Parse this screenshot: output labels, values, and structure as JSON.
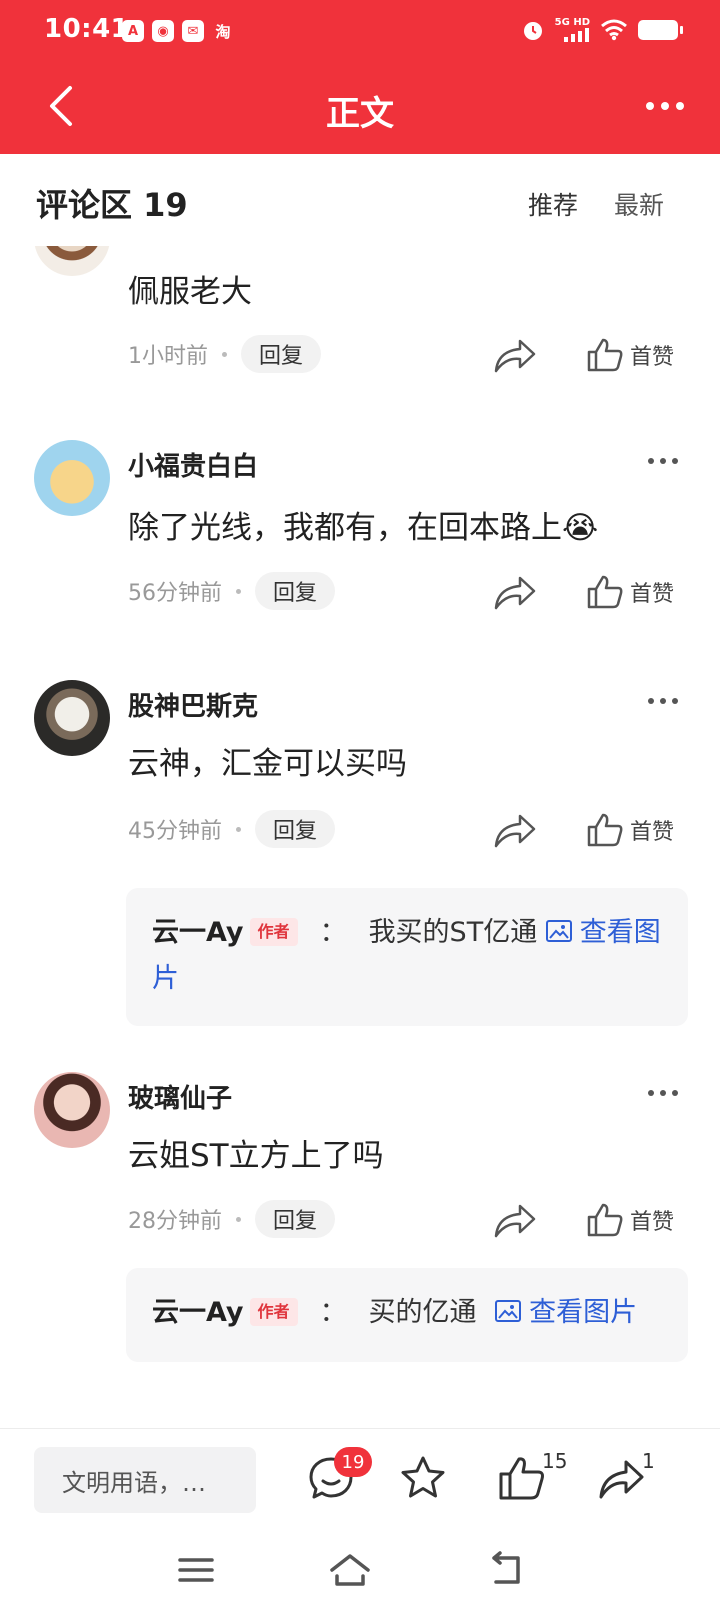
{
  "status_bar": {
    "time": "10:41",
    "apps": [
      "A",
      "◉",
      "✉",
      "淘"
    ],
    "network": "5G HD"
  },
  "nav": {
    "title": "正文"
  },
  "comments_header": {
    "title": "评论区 19",
    "tab_recommend": "推荐",
    "tab_latest": "最新"
  },
  "comments": [
    {
      "name": "",
      "content": "佩服老大",
      "time": "1小时前",
      "reply_label": "回复",
      "like_label": "首赞"
    },
    {
      "name": "小福贵白白",
      "content": "除了光线，我都有，在回本路上😭",
      "time": "56分钟前",
      "reply_label": "回复",
      "like_label": "首赞"
    },
    {
      "name": "股神巴斯克",
      "content": "云神，汇金可以买吗",
      "time": "45分钟前",
      "reply_label": "回复",
      "like_label": "首赞",
      "subreply": {
        "name": "云一Ay",
        "tag": "作者",
        "colon": "：",
        "text": "我买的ST亿通",
        "link": "查看图片"
      }
    },
    {
      "name": "玻璃仙子",
      "content": "云姐ST立方上了吗",
      "time": "28分钟前",
      "reply_label": "回复",
      "like_label": "首赞",
      "subreply": {
        "name": "云一Ay",
        "tag": "作者",
        "colon": "：",
        "text": "买的亿通",
        "link": "查看图片"
      }
    }
  ],
  "bottom_bar": {
    "input_placeholder": "文明用语，…",
    "comment_count": "19",
    "like_count": "15",
    "share_count": "1"
  },
  "colors": {
    "brand_red": "#f0323b",
    "link_blue": "#2e5fd6"
  },
  "icons": [
    "back-arrow-icon",
    "more-dots-icon",
    "share-icon",
    "thumb-up-icon",
    "image-icon",
    "comment-icon",
    "star-icon",
    "menu-icon",
    "home-icon",
    "back-icon"
  ]
}
